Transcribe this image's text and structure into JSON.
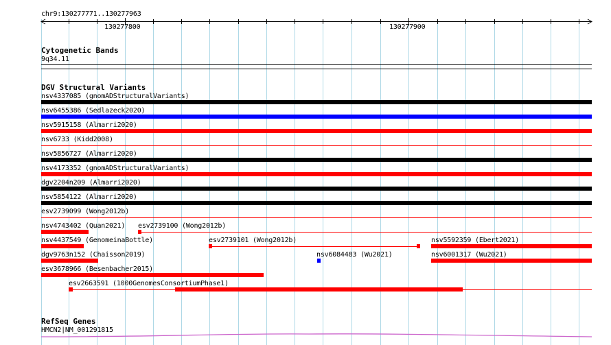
{
  "ruler": {
    "region_label": "chr9:130277771..130277963",
    "ticks": [
      "130277800",
      "130277900"
    ]
  },
  "cytoband_track": {
    "title": "Cytogenetic Bands",
    "band": "9q34.11"
  },
  "dgv_track": {
    "title": "DGV Structural Variants",
    "features": [
      {
        "label": "nsv4337085 (gnomADStructuralVariants)",
        "color": "#000000",
        "style": "thick"
      },
      {
        "label": "nsv6455386 (Sedlazeck2020)",
        "color": "#0000ff",
        "style": "thick"
      },
      {
        "label": "nsv5915158 (Almarri2020)",
        "color": "#ff0000",
        "style": "thick"
      },
      {
        "label": "nsv6733 (Kidd2008)",
        "color": "#ff0000",
        "style": "line"
      },
      {
        "label": "nsv5856727 (Almarri2020)",
        "color": "#000000",
        "style": "thick"
      },
      {
        "label": "nsv4173352 (gnomADStructuralVariants)",
        "color": "#ff0000",
        "style": "thick"
      },
      {
        "label": "dgv2204n209 (Almarri2020)",
        "color": "#000000",
        "style": "thick"
      },
      {
        "label": "nsv5854122 (Almarri2020)",
        "color": "#000000",
        "style": "thick"
      },
      {
        "label": "esv2739099 (Wong2012b)",
        "color": "#ff0000",
        "style": "line"
      },
      {
        "label": "nsv4743402 (Quan2021)",
        "color": "#ff0000",
        "style": "thick"
      },
      {
        "label": "esv2739100 (Wong2012b)",
        "color": "#ff0000",
        "style": "split"
      },
      {
        "label": "nsv4437549 (GenomeinaBottle)",
        "color": "#ff0000",
        "style": "thick"
      },
      {
        "label": "esv2739101 (Wong2012b)",
        "color": "#ff0000",
        "style": "split"
      },
      {
        "label": "nsv5592359 (Ebert2021)",
        "color": "#ff0000",
        "style": "thick"
      },
      {
        "label": "dgv9763n152 (Chaisson2019)",
        "color": "#ff0000",
        "style": "thick"
      },
      {
        "label": "nsv6084483 (Wu2021)",
        "color": "#0000ff",
        "style": "small"
      },
      {
        "label": "nsv6001317 (Wu2021)",
        "color": "#ff0000",
        "style": "thick"
      },
      {
        "label": "esv3678966 (Besenbacher2015)",
        "color": "#ff0000",
        "style": "thick"
      },
      {
        "label": "esv2663591 (1000GenomesConsortiumPhase1)",
        "color": "#ff0000",
        "style": "split"
      }
    ]
  },
  "refseq_track": {
    "title": "RefSeq Genes",
    "gene": "HMCN2|NM_001291815"
  },
  "colors": {
    "grid": "#add8e6",
    "ruler": "#000000",
    "band": "#000000",
    "gene": "#cc66cc"
  }
}
